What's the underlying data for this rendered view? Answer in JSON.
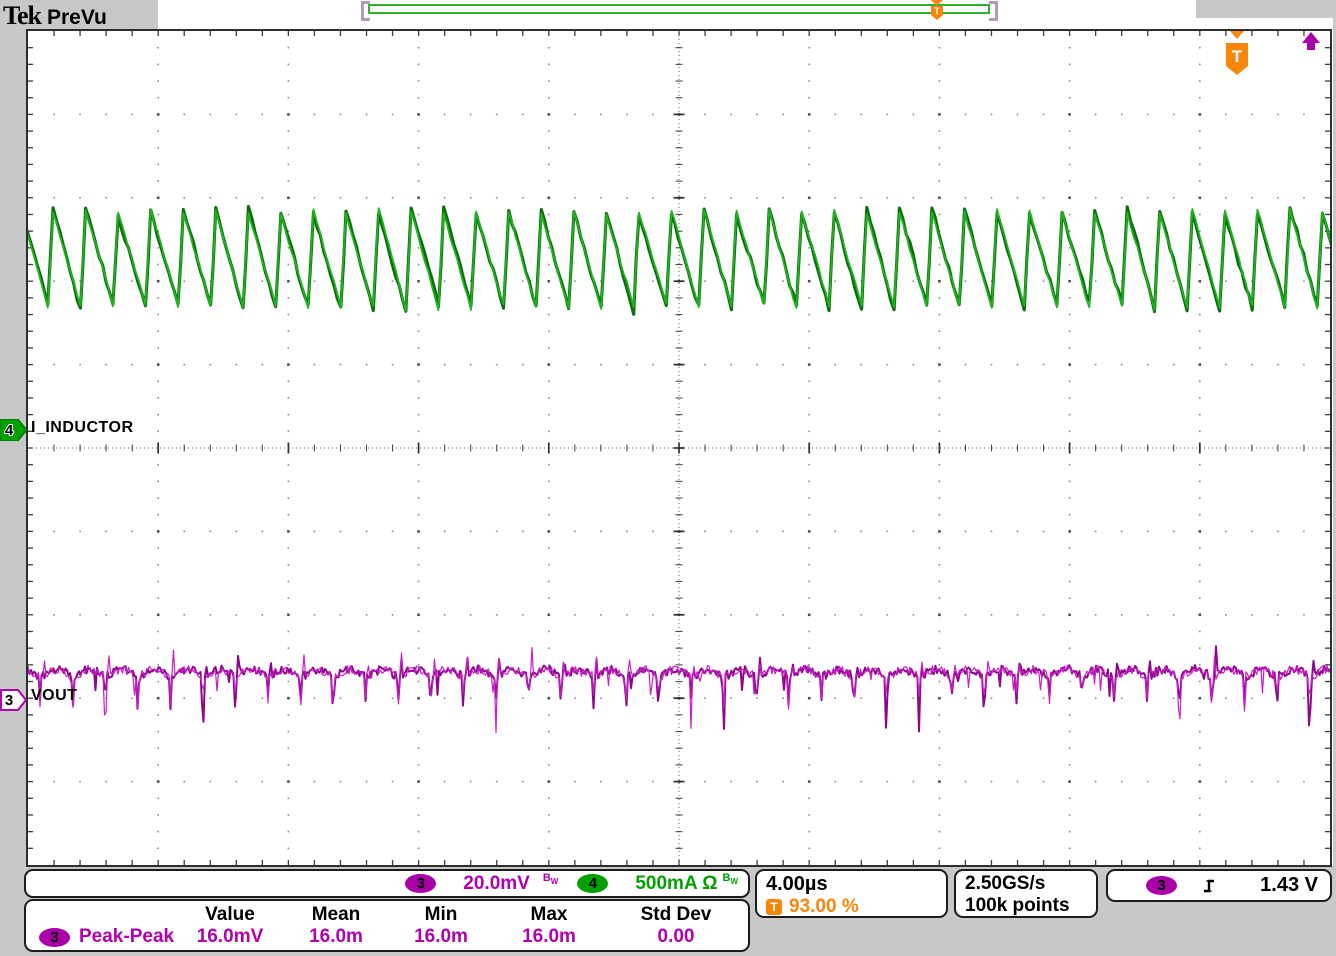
{
  "header": {
    "brand": "Tek",
    "mode": "PreVu"
  },
  "acq_bar": {
    "t_label": "T"
  },
  "trigger_flag": {
    "t_label": "T"
  },
  "channels": {
    "ch4": {
      "id": "4",
      "label": "I_INDUCTOR",
      "color": "#00a000"
    },
    "ch3": {
      "id": "3",
      "label": "VOUT",
      "color": "#aa00aa"
    }
  },
  "readouts": {
    "ch3_badge": "3",
    "ch3_scale": "20.0mV",
    "ch3_bw": {
      "main": "B",
      "sub": "W"
    },
    "ch4_badge": "4",
    "ch4_scale": "500mA Ω",
    "ch4_bw": {
      "main": "B",
      "sub": "W"
    },
    "timebase": "4.00µs",
    "trig_t": "T",
    "trig_position": "93.00 %",
    "sample_rate": "2.50GS/s",
    "record_length": "100k points",
    "trig_badge": "3",
    "trig_level": "1.43 V"
  },
  "measurements": {
    "headers": [
      "Value",
      "Mean",
      "Min",
      "Max",
      "Std Dev"
    ],
    "rows": [
      {
        "badge": "3",
        "name": "Peak-Peak",
        "value": "16.0mV",
        "mean": "16.0m",
        "min": "16.0m",
        "max": "16.0m",
        "std": "0.00"
      }
    ]
  },
  "colors": {
    "ch3_magenta": "#aa00aa",
    "ch4_green": "#00a000",
    "trigger_orange": "#f8860a",
    "graticule_dot": "#8a8a8a"
  },
  "chart_data": {
    "type": "line",
    "title": "",
    "x_axis": {
      "unit": "µs",
      "per_div": 4.0,
      "divisions": 10,
      "total": 40
    },
    "y_divisions": 10,
    "grid": "dotted-divisions-with-center-crosshair",
    "series": [
      {
        "name": "I_INDUCTOR",
        "channel": 4,
        "color": "#1fb31f",
        "shape": "sawtooth",
        "units": "mA",
        "per_div": 500,
        "period_us": 1.0,
        "rise_fraction": 0.16,
        "peak": 1310,
        "trough": 735,
        "zero_ref_div_from_center": 0.22
      },
      {
        "name": "VOUT",
        "channel": 3,
        "color": "#b313b3",
        "shape": "noisy_ripple",
        "units": "mV",
        "per_div": 20,
        "period_us": 1.0,
        "ref_div_from_center": -3.02,
        "band_center_mV": 5.8,
        "band_noise_mV_pp": 2.2,
        "ripple_mV": 1.5,
        "spike_min_mV": -8.5,
        "spike_max_mV": 11.0,
        "peak_to_peak_mV": 16.0
      }
    ]
  }
}
